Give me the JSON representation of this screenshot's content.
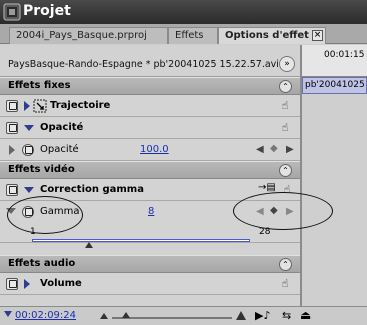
{
  "window": {
    "title": "Projet",
    "icon": "premiere-app-icon"
  },
  "tabs": [
    {
      "label": "2004i_Pays_Basque.prproj"
    },
    {
      "label": "Effets"
    },
    {
      "label": "Options d'effet"
    }
  ],
  "clip": {
    "name": "PaysBasque-Rando-Espagne * pb'20041025 15.22.57.avi"
  },
  "timeline": {
    "ruler_time": "00:01:15",
    "clip_label": "pb'20041025"
  },
  "sections": {
    "fixed": "Effets fixes",
    "video": "Effets vidéo",
    "audio": "Effets audio"
  },
  "effects": {
    "trajectoire": "Trajectoire",
    "opacite": "Opacité",
    "opacite_param": "Opacité",
    "opacite_value": "100.0",
    "gamma_correction": "Correction gamma",
    "gamma_param": "Gamma",
    "gamma_value": "8",
    "gamma_min": "1",
    "gamma_max": "28",
    "gamma_slider_fraction": 0.26,
    "volume": "Volume"
  },
  "bottom": {
    "timecode": "00:02:09:24"
  }
}
